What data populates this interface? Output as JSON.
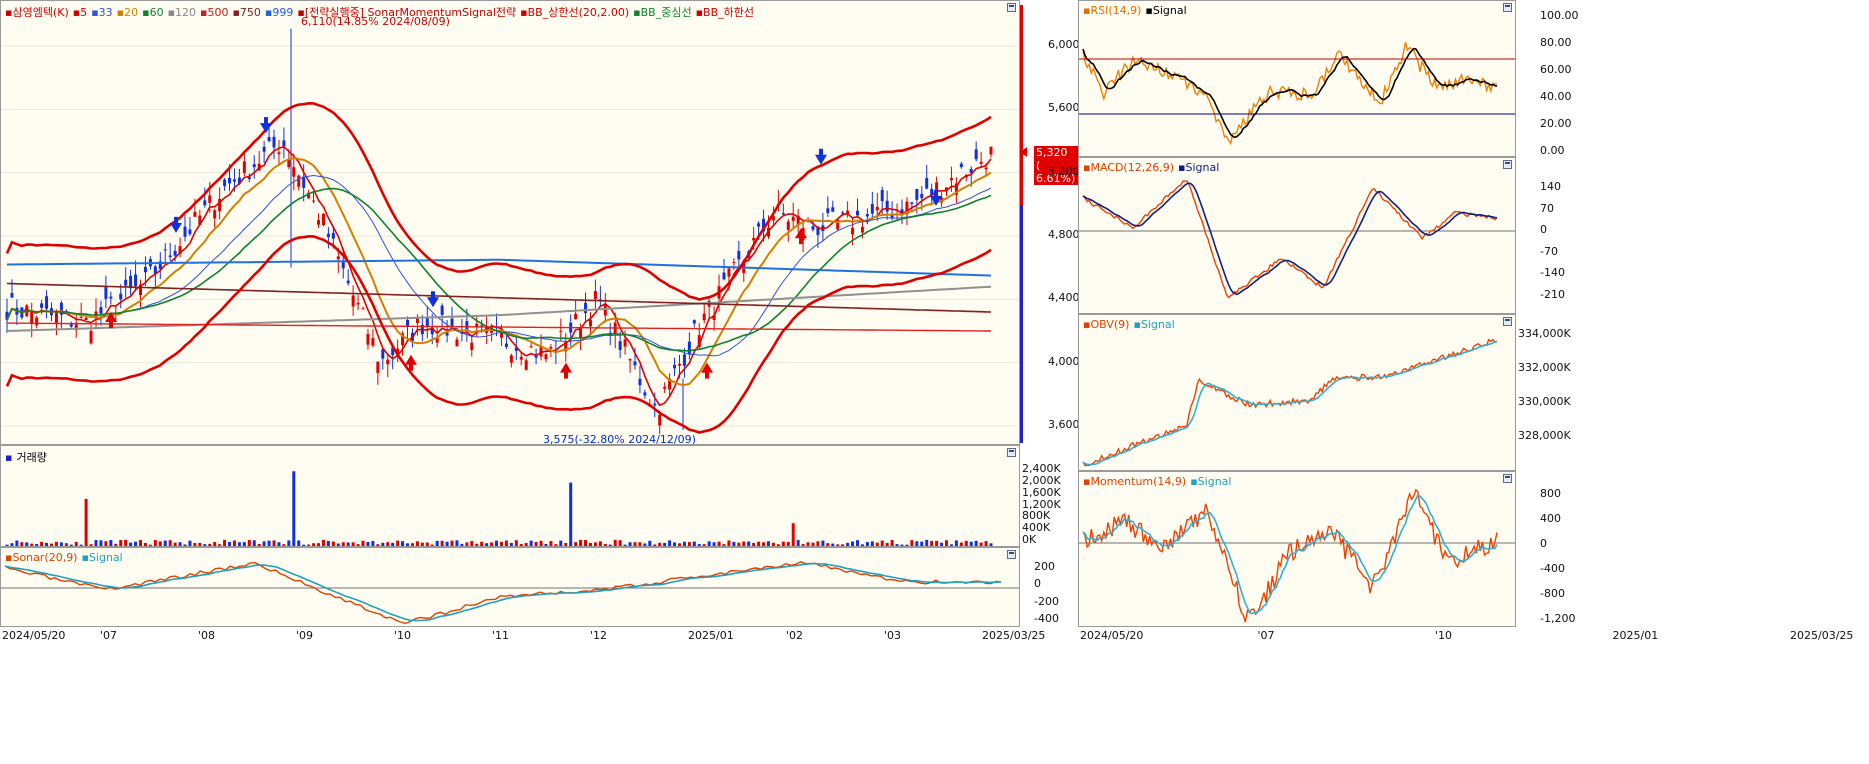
{
  "main": {
    "legend": [
      {
        "text": "삼영엠텍(K)",
        "color": "#d00000"
      },
      {
        "text": "5",
        "color": "#d00000"
      },
      {
        "text": "33",
        "color": "#3050e0"
      },
      {
        "text": "20",
        "color": "#d08000"
      },
      {
        "text": "60",
        "color": "#108030"
      },
      {
        "text": "120",
        "color": "#888888"
      },
      {
        "text": "500",
        "color": "#c02020"
      },
      {
        "text": "750",
        "color": "#802020"
      },
      {
        "text": "999",
        "color": "#2060e0"
      },
      {
        "text": "[전략실행중] SonarMomentumSignal전략",
        "color": "#c00000"
      },
      {
        "text": "BB_상한선(20,2.00)",
        "color": "#d00000"
      },
      {
        "text": "BB_중심선",
        "color": "#108030"
      },
      {
        "text": "BB_하한선",
        "color": "#d00000"
      }
    ],
    "price_ticks": [
      "6,000",
      "5,600",
      "5,200",
      "4,800",
      "4,400",
      "4,000",
      "3,600"
    ],
    "high_annotation": "6,110(14.85% 2024/08/09)",
    "low_annotation": "3,575(-32.80% 2024/12/09)",
    "current_price": "5,320",
    "current_change": "( 6.61%)"
  },
  "volume": {
    "title": "거래량",
    "ticks": [
      "2,400K",
      "2,000K",
      "1,600K",
      "1,200K",
      "800K",
      "400K",
      "0K"
    ]
  },
  "sonar": {
    "legend": [
      {
        "text": "Sonar(20,9)",
        "color": "#e04000"
      },
      {
        "text": "Signal",
        "color": "#20a0c0"
      }
    ],
    "ticks": [
      "200",
      "0",
      "-200",
      "-400"
    ]
  },
  "dates_main": [
    "2024/05/20",
    "'07",
    "'08",
    "'09",
    "'10",
    "'11",
    "'12",
    "2025/01",
    "'02",
    "'03",
    "2025/03/25"
  ],
  "rsi": {
    "legend": [
      {
        "text": "RSI(14,9)",
        "color": "#e07000"
      },
      {
        "text": "Signal",
        "color": "#000000"
      }
    ],
    "ticks": [
      "100.00",
      "80.00",
      "60.00",
      "40.00",
      "20.00",
      "0.00"
    ]
  },
  "macd": {
    "legend": [
      {
        "text": "MACD(12,26,9)",
        "color": "#e04000"
      },
      {
        "text": "Signal",
        "color": "#102080"
      }
    ],
    "ticks": [
      "140",
      "70",
      "0",
      "-70",
      "-140",
      "-210"
    ]
  },
  "obv": {
    "legend": [
      {
        "text": "OBV(9)",
        "color": "#e04000"
      },
      {
        "text": "Signal",
        "color": "#20a0c0"
      }
    ],
    "ticks": [
      "334,000K",
      "332,000K",
      "330,000K",
      "328,000K"
    ]
  },
  "momentum": {
    "legend": [
      {
        "text": "Momentum(14,9)",
        "color": "#e04000"
      },
      {
        "text": "Signal",
        "color": "#20a0c0"
      }
    ],
    "ticks": [
      "800",
      "400",
      "0",
      "-400",
      "-800",
      "-1,200"
    ]
  },
  "dates_right": [
    "2024/05/20",
    "'07",
    "'10",
    "2025/01",
    "2025/03/25"
  ]
}
